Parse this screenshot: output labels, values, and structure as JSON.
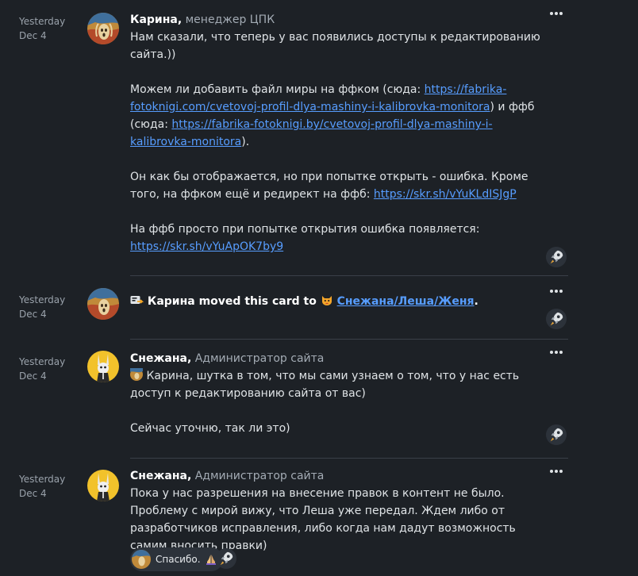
{
  "comments": [
    {
      "day": "Yesterday",
      "date": "Dec 4",
      "author": "Карина,",
      "role": "менеджер ЦПК",
      "p1": "Нам сказали, что теперь у вас появились доступы к редактированию сайта.))",
      "p2_a": "Можем ли добавить файл миры на ффком (сюда: ",
      "link1": "https://fabrika-fotoknigi.com/cvetovoj-profil-dlya-mashiny-i-kalibrovka-monitora",
      "p2_b": ") и ффб (сюда: ",
      "link2": "https://fabrika-fotoknigi.by/cvetovoj-profil-dlya-mashiny-i-kalibrovka-monitora",
      "p2_c": ").",
      "p3_a": "Он как бы отображается, но при попытке открыть - ошибка. Кроме того, на ффком ещё и редирект на ффб: ",
      "link3": "https://skr.sh/vYuKLdISJgP",
      "p4": "На ффб просто при попытке открытия ошибка появляется:",
      "link4": "https://skr.sh/vYuApOK7by9"
    },
    {
      "day": "Yesterday",
      "date": "Dec 4",
      "text_a": "Карина moved this card to ",
      "list": "Снежана/Леша/Женя",
      "text_b": "."
    },
    {
      "day": "Yesterday",
      "date": "Dec 4",
      "author": "Снежана,",
      "role": "Администратор сайта",
      "p1": "Карина, шутка в том, что мы сами узнаем о том, что у нас есть доступ к редактированию сайта от вас)",
      "p2": "Сейчас уточню, так ли это)"
    },
    {
      "day": "Yesterday",
      "date": "Dec 4",
      "author": "Снежана,",
      "role": "Администратор сайта",
      "p1": "Пока у нас разрешения на внесение правок в контент не было. Проблему с мирой вижу, что Леша уже передал. Ждем либо от разработчиков исправления, либо когда нам дадут возможность самим вносить правки)",
      "reaction_text": "Спасибо."
    }
  ],
  "icons": {
    "more": "more-horizontal-icon",
    "reaction": "add-reaction-rocket-icon",
    "card_move": "card-move-icon",
    "list_emoji": "cat-face-icon",
    "thanks_emoji": "praying-hands-icon"
  },
  "colors": {
    "background": "#1d2126",
    "link": "#579dff",
    "separator": "#3a4048"
  }
}
